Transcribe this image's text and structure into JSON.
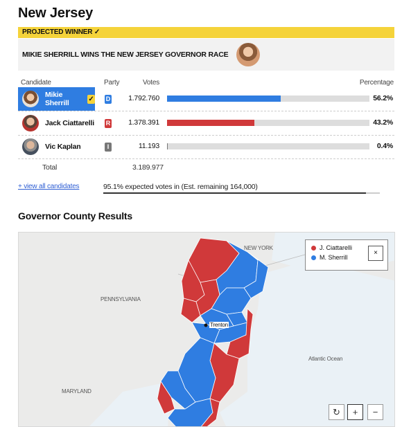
{
  "page": {
    "title": "New Jersey"
  },
  "winner": {
    "banner": "PROJECTED WINNER ✓",
    "headline": "MIKIE SHERRILL WINS THE NEW JERSEY GOVERNOR RACE"
  },
  "table": {
    "headers": {
      "candidate": "Candidate",
      "party": "Party",
      "votes": "Votes",
      "percentage": "Percentage"
    },
    "rows": [
      {
        "name": "Mikie Sherrill",
        "party": "D",
        "votes": "1.792.760",
        "pct": "56.2%",
        "share": 0.562,
        "color": "#2f7de1",
        "winner": true
      },
      {
        "name": "Jack Ciattarelli",
        "party": "R",
        "votes": "1.378.391",
        "pct": "43.2%",
        "share": 0.432,
        "color": "#d0393a",
        "winner": false
      },
      {
        "name": "Vic Kaplan",
        "party": "I",
        "votes": "11.193",
        "pct": "0.4%",
        "share": 0.004,
        "color": "#777777",
        "winner": false
      }
    ],
    "total_label": "Total",
    "total_votes": "3.189.977"
  },
  "footer": {
    "view_all": "+ view all candidates",
    "expected": "95.1% expected votes in (Est. remaining 164,000)",
    "expected_share": 0.951
  },
  "map": {
    "title": "Governor County Results",
    "labels": {
      "new_york": "NEW YORK",
      "pennsylvania": "PENNSYLVANIA",
      "trenton": "Trenton",
      "atlantic": "Atlantic Ocean",
      "maryland": "MARYLAND"
    },
    "legend": [
      {
        "name": "J. Ciattarelli",
        "color": "#d0393a"
      },
      {
        "name": "M. Sherrill",
        "color": "#2f7de1"
      }
    ],
    "legend_close": "×",
    "controls": {
      "reset": "↻",
      "zoom_in": "+",
      "zoom_out": "−"
    }
  },
  "colors": {
    "democrat": "#2f7de1",
    "republican": "#d0393a",
    "independent": "#777777",
    "accent": "#f5d33a"
  }
}
